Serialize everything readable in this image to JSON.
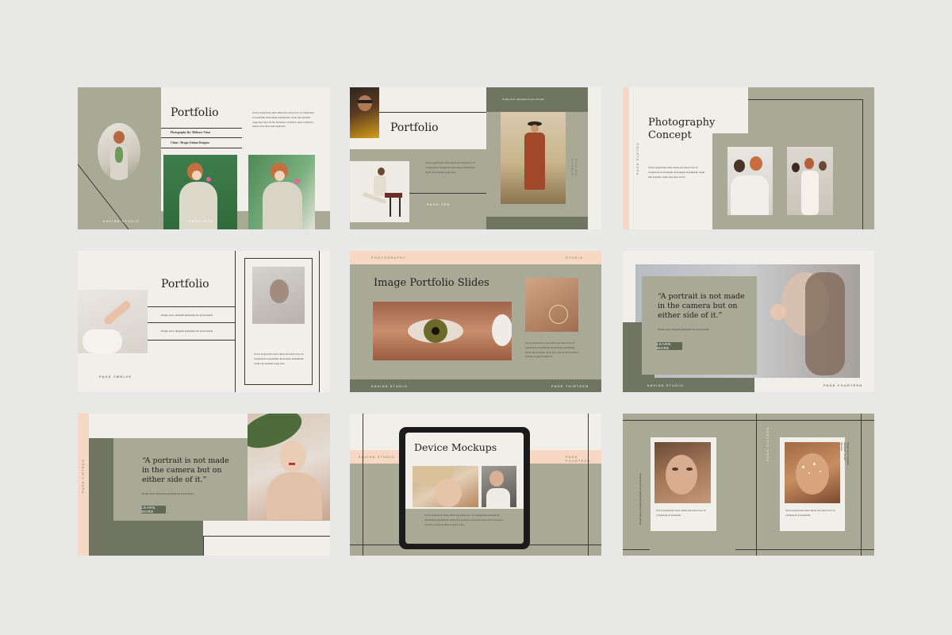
{
  "colors": {
    "sage": "#a8aa95",
    "dark_sage": "#6f7560",
    "cream": "#f0efe9",
    "peach": "#f7d8c5"
  },
  "s1": {
    "title": "Portfolio",
    "credit_a": "Photography By: Melisaer Vieno",
    "credit_b": "Client : Hergio Fabian Designer",
    "body": "Sed ut perspiciatis unde omnis iste natus error sit voluptatem accusantium doloremque laudantium, totam rem aperiam, eaque ipsa quae ab illo inventore veritatis et quasi architecto beatae vitae dicta sunt explicabo.",
    "footer_left": "KAVINA STUDIO",
    "footer_right": "PAGE NINE"
  },
  "s2": {
    "title": "Portfolio",
    "quote": "Neque porro quisquam est qui dolorem",
    "body": "Sed ut perspiciatis unde omnis iste natus error sit voluptatem accusantium doloremque laudantium, totam rem aperiam eaque ipsa.",
    "page": "PAGE TEN",
    "side": "KAVINA STUDIO"
  },
  "s3": {
    "title": "Photography Concept",
    "body": "Sed ut perspiciatis unde omnis iste natus error sit voluptatem accusantium doloremque laudantium, totam rem aperiam, eaque ipsa quae ab illo.",
    "side": "PAGE ELEVEN"
  },
  "s4": {
    "title": "Portfolio",
    "item_a": "Neque porro aliquam quisquam est qui dolorem",
    "item_b": "Neque porro aliquam quisquam est qui dolorem",
    "body": "Sed ut perspiciatis unde omnis iste natus error sit voluptatem accusantium doloremque laudantium, totam rem aperiam eaque ipsa.",
    "page": "PAGE TWELVE"
  },
  "s5": {
    "title": "Image Portfolio Slides",
    "top_left": "PHOTOGRAPHY",
    "top_right": "STUDIO",
    "body": "Sed ut perspiciatis unde omnis iste natus error sit voluptatem accusantium doloremque laudantium, totam rem aperiam, eaque ipsa quae ab illo inventore veritatis et quasi architecto.",
    "footer_left": "KAVINA STUDIO",
    "footer_right": "PAGE THIRTEEN"
  },
  "s6": {
    "quote": "“A portrait is not made in the camera but on either side of it.”",
    "sub": "Neque porro aliquam quisquam est qui dolorem",
    "button": "LEARN MORE",
    "footer_left": "KAVINA STUDIO",
    "footer_right": "PAGE FOURTEEN"
  },
  "s7": {
    "quote": "“A portrait is not made in the camera but on either side of it.”",
    "sub": "Neque porro aliquam quisquam est qui dolorem",
    "button": "LEARN MORE",
    "side": "PAGE FIFTEEN"
  },
  "s8": {
    "title": "Device Mockups",
    "left_band": "KAVINA STUDIO",
    "right_band": "PAGE FOURTEEN",
    "body": "Sed ut perspiciatis unde omnis iste natus error sit voluptatem accusantium doloremque laudantium, totam rem aperiam, eaque ipsa quae ab illo inventore veritatis et quasi architecto beatae vitae."
  },
  "s9": {
    "caption_a": "Sed ut perspiciatis unde omnis iste natus error sit voluptatem accusantium.",
    "caption_b": "Sed ut perspiciatis unde omnis iste natus error sit voluptatem accusantium.",
    "side_a": "Neque porro aliquam quisquam est qui dolorem",
    "side_b": "Neque porro aliquam quisquam est qui dolorem",
    "side_label": "PAGE SIXTEEN"
  }
}
